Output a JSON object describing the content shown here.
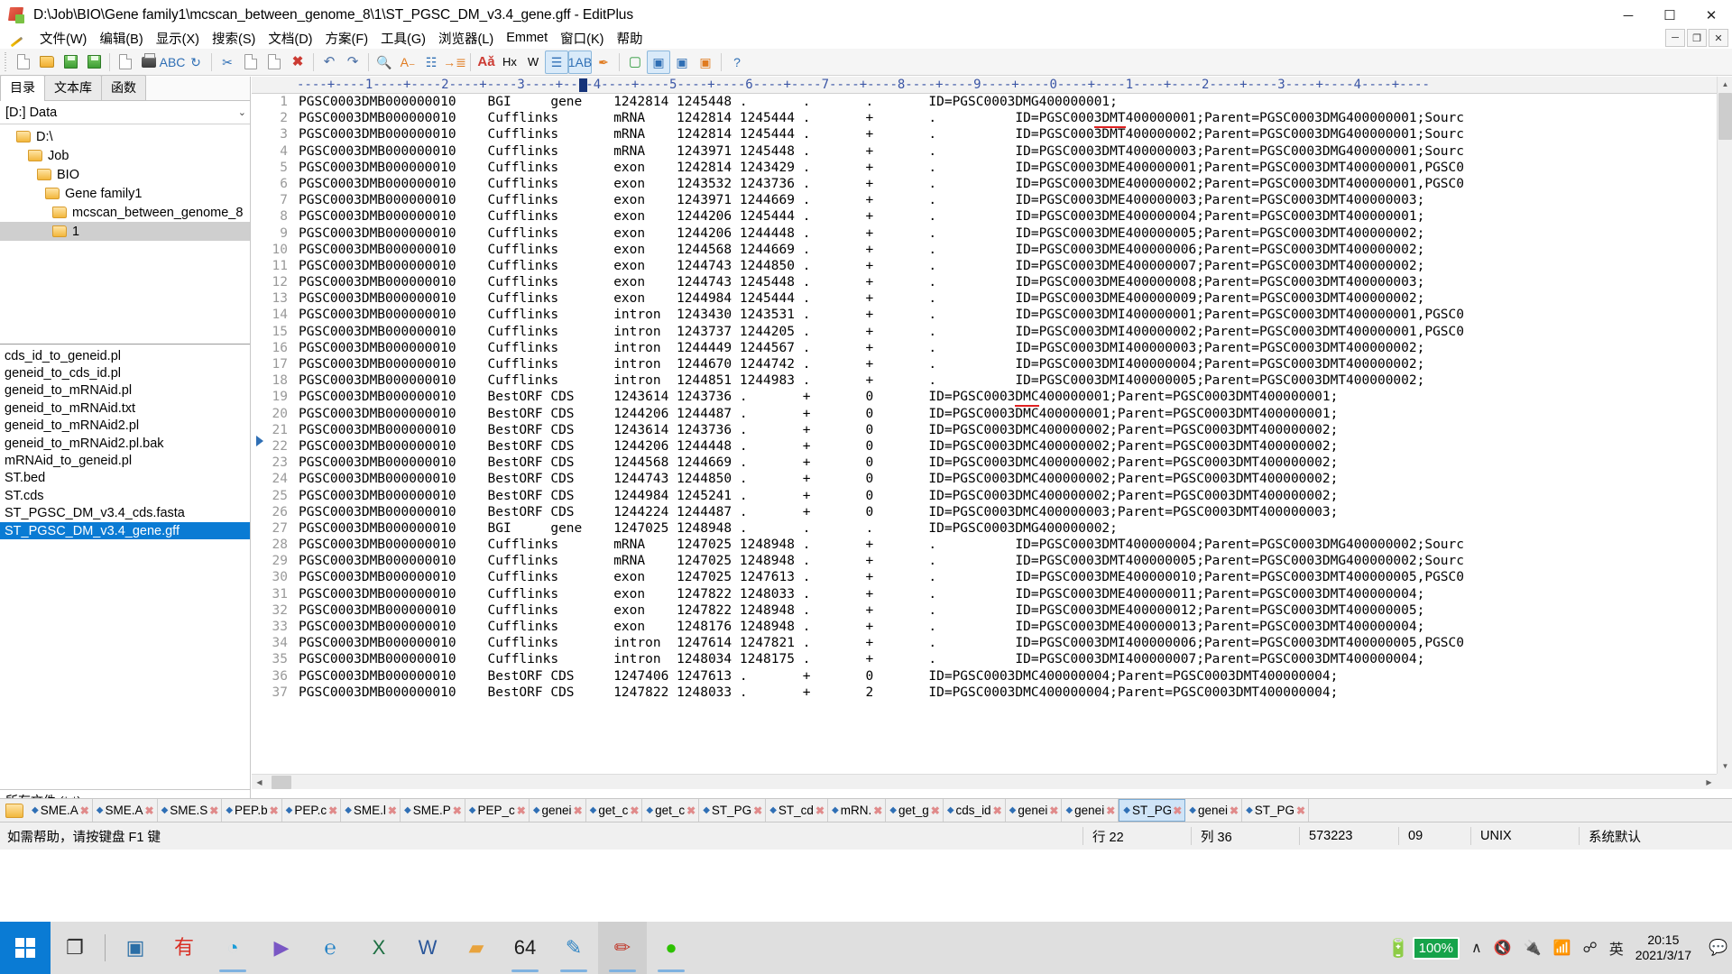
{
  "window": {
    "title": "D:\\Job\\BIO\\Gene family1\\mcscan_between_genome_8\\1\\ST_PGSC_DM_v3.4_gene.gff - EditPlus",
    "minimize": "─",
    "maximize": "☐",
    "close": "✕",
    "app_icon": "editplus-icon"
  },
  "menu": {
    "items": [
      {
        "label": "文件(W)"
      },
      {
        "label": "编辑(B)"
      },
      {
        "label": "显示(X)"
      },
      {
        "label": "搜索(S)"
      },
      {
        "label": "文档(D)"
      },
      {
        "label": "方案(F)"
      },
      {
        "label": "工具(G)"
      },
      {
        "label": "浏览器(L)"
      },
      {
        "label": "Emmet"
      },
      {
        "label": "窗口(K)"
      },
      {
        "label": "帮助"
      }
    ],
    "doc_buttons": [
      "─",
      "❐",
      "✕"
    ]
  },
  "toolbar": {
    "groups": [
      [
        "new-file-icon",
        "open-file-icon",
        "save-file-icon",
        "save-all-icon"
      ],
      [
        "print-preview-icon",
        "print-icon",
        "spell-check-icon",
        "reload-icon"
      ],
      [
        "cut-icon",
        "copy-icon",
        "paste-icon",
        "delete-icon"
      ],
      [
        "undo-icon",
        "redo-icon"
      ],
      [
        "find-icon",
        "replace-icon",
        "find-in-files-icon",
        "goto-line-icon"
      ],
      [
        "font-icon",
        "hex-viewer-icon",
        "word-wrap-icon"
      ],
      [
        "line-numbers-icon",
        "show-spaces-icon",
        "highlight-icon"
      ],
      [
        "preview-browser-icon",
        "browser-ie-icon",
        "browser-chrome-icon",
        "browser-firefox-icon"
      ],
      [
        "help-icon"
      ]
    ]
  },
  "sidebar": {
    "tabs": [
      {
        "label": "目录",
        "selected": true
      },
      {
        "label": "文本库",
        "selected": false
      },
      {
        "label": "函数",
        "selected": false
      }
    ],
    "drive": "[D:] Data",
    "drive_chevron": "⌄",
    "tree": [
      {
        "label": "D:\\",
        "depth": 0,
        "selected": false
      },
      {
        "label": "Job",
        "depth": 1,
        "selected": false
      },
      {
        "label": "BIO",
        "depth": 2,
        "selected": false
      },
      {
        "label": "Gene family1",
        "depth": 3,
        "selected": false
      },
      {
        "label": "mcscan_between_genome_8",
        "depth": 4,
        "selected": false
      },
      {
        "label": "1",
        "depth": 5,
        "selected": true
      }
    ],
    "files": [
      {
        "name": "cds_id_to_geneid.pl",
        "selected": false
      },
      {
        "name": "geneid_to_cds_id.pl",
        "selected": false
      },
      {
        "name": "geneid_to_mRNAid.pl",
        "selected": false
      },
      {
        "name": "geneid_to_mRNAid.txt",
        "selected": false
      },
      {
        "name": "geneid_to_mRNAid2.pl",
        "selected": false
      },
      {
        "name": "geneid_to_mRNAid2.pl.bak",
        "selected": false
      },
      {
        "name": "mRNAid_to_geneid.pl",
        "selected": false
      },
      {
        "name": "ST.bed",
        "selected": false
      },
      {
        "name": "ST.cds",
        "selected": false
      },
      {
        "name": "ST_PGSC_DM_v3.4_cds.fasta",
        "selected": false
      },
      {
        "name": "ST_PGSC_DM_v3.4_gene.gff",
        "selected": true
      }
    ],
    "filter": "所有文件 (*.*)",
    "filter_chevron": "⌄"
  },
  "editor": {
    "ruler": "----+----1----+----2----+----3----+----4----+----5----+----6----+----7----+----8----+----9----+----0----+----1----+----2----+----3----+----4----+----",
    "lines": [
      {
        "n": "1",
        "pre": "PGSC0003DMB000000010    BGI     gene    1242814 1245448 .       .       .       ID=PGSC0003DMG400000001;",
        "ul": "",
        "post": ""
      },
      {
        "n": "2",
        "pre": "PGSC0003DMB000000010    Cufflinks       mRNA    1242814 1245444 .       +       .          ID=PGSC000",
        "ul": "3DMT",
        "post": "400000001;Parent=PGSC0003DMG400000001;Sourc"
      },
      {
        "n": "3",
        "pre": "PGSC0003DMB000000010    Cufflinks       mRNA    1242814 1245444 .       +       .          ID=PGSC0003DMT400000002;Parent=PGSC0003DMG400000001;Sourc",
        "ul": "",
        "post": ""
      },
      {
        "n": "4",
        "pre": "PGSC0003DMB000000010    Cufflinks       mRNA    1243971 1245448 .       +       .          ID=PGSC0003DMT400000003;Parent=PGSC0003DMG400000001;Sourc",
        "ul": "",
        "post": ""
      },
      {
        "n": "5",
        "pre": "PGSC0003DMB000000010    Cufflinks       exon    1242814 1243429 .       +       .          ID=PGSC0003DME400000001;Parent=PGSC0003DMT400000001,PGSC0",
        "ul": "",
        "post": ""
      },
      {
        "n": "6",
        "pre": "PGSC0003DMB000000010    Cufflinks       exon    1243532 1243736 .       +       .          ID=PGSC0003DME400000002;Parent=PGSC0003DMT400000001,PGSC0",
        "ul": "",
        "post": ""
      },
      {
        "n": "7",
        "pre": "PGSC0003DMB000000010    Cufflinks       exon    1243971 1244669 .       +       .          ID=PGSC0003DME400000003;Parent=PGSC0003DMT400000003;",
        "ul": "",
        "post": ""
      },
      {
        "n": "8",
        "pre": "PGSC0003DMB000000010    Cufflinks       exon    1244206 1245444 .       +       .          ID=PGSC0003DME400000004;Parent=PGSC0003DMT400000001;",
        "ul": "",
        "post": ""
      },
      {
        "n": "9",
        "pre": "PGSC0003DMB000000010    Cufflinks       exon    1244206 1244448 .       +       .          ID=PGSC0003DME400000005;Parent=PGSC0003DMT400000002;",
        "ul": "",
        "post": ""
      },
      {
        "n": "10",
        "pre": "PGSC0003DMB000000010    Cufflinks       exon    1244568 1244669 .       +       .          ID=PGSC0003DME400000006;Parent=PGSC0003DMT400000002;",
        "ul": "",
        "post": ""
      },
      {
        "n": "11",
        "pre": "PGSC0003DMB000000010    Cufflinks       exon    1244743 1244850 .       +       .          ID=PGSC0003DME400000007;Parent=PGSC0003DMT400000002;",
        "ul": "",
        "post": ""
      },
      {
        "n": "12",
        "pre": "PGSC0003DMB000000010    Cufflinks       exon    1244743 1245448 .       +       .          ID=PGSC0003DME400000008;Parent=PGSC0003DMT400000003;",
        "ul": "",
        "post": ""
      },
      {
        "n": "13",
        "pre": "PGSC0003DMB000000010    Cufflinks       exon    1244984 1245444 .       +       .          ID=PGSC0003DME400000009;Parent=PGSC0003DMT400000002;",
        "ul": "",
        "post": ""
      },
      {
        "n": "14",
        "pre": "PGSC0003DMB000000010    Cufflinks       intron  1243430 1243531 .       +       .          ID=PGSC0003DMI400000001;Parent=PGSC0003DMT400000001,PGSC0",
        "ul": "",
        "post": ""
      },
      {
        "n": "15",
        "pre": "PGSC0003DMB000000010    Cufflinks       intron  1243737 1244205 .       +       .          ID=PGSC0003DMI400000002;Parent=PGSC0003DMT400000001,PGSC0",
        "ul": "",
        "post": ""
      },
      {
        "n": "16",
        "pre": "PGSC0003DMB000000010    Cufflinks       intron  1244449 1244567 .       +       .          ID=PGSC0003DMI400000003;Parent=PGSC0003DMT400000002;",
        "ul": "",
        "post": ""
      },
      {
        "n": "17",
        "pre": "PGSC0003DMB000000010    Cufflinks       intron  1244670 1244742 .       +       .          ID=PGSC0003DMI400000004;Parent=PGSC0003DMT400000002;",
        "ul": "",
        "post": ""
      },
      {
        "n": "18",
        "pre": "PGSC0003DMB000000010    Cufflinks       intron  1244851 1244983 .       +       .          ID=PGSC0003DMI400000005;Parent=PGSC0003DMT400000002;",
        "ul": "",
        "post": ""
      },
      {
        "n": "19",
        "pre": "PGSC0003DMB000000010    BestORF CDS     1243614 1243736 .       +       0       ID=PGSC0003",
        "ul": "DMC",
        "post": "400000001;Parent=PGSC0003DMT400000001;"
      },
      {
        "n": "20",
        "pre": "PGSC0003DMB000000010    BestORF CDS     1244206 1244487 .       +       0       ID=PGSC0003DMC400000001;Parent=PGSC0003DMT400000001;",
        "ul": "",
        "post": ""
      },
      {
        "n": "21",
        "pre": "PGSC0003DMB000000010    BestORF CDS     1243614 1243736 .       +       0       ID=PGSC0003DMC400000002;Parent=PGSC0003DMT400000002;",
        "ul": "",
        "post": ""
      },
      {
        "n": "22",
        "pre": "PGSC0003DMB000000010    BestORF CDS     1244206 1244448 .       +       0       ID=PGSC0003DMC400000002;Parent=PGSC0003DMT400000002;",
        "ul": "",
        "post": ""
      },
      {
        "n": "23",
        "pre": "PGSC0003DMB000000010    BestORF CDS     1244568 1244669 .       +       0       ID=PGSC0003DMC400000002;Parent=PGSC0003DMT400000002;",
        "ul": "",
        "post": ""
      },
      {
        "n": "24",
        "pre": "PGSC0003DMB000000010    BestORF CDS     1244743 1244850 .       +       0       ID=PGSC0003DMC400000002;Parent=PGSC0003DMT400000002;",
        "ul": "",
        "post": ""
      },
      {
        "n": "25",
        "pre": "PGSC0003DMB000000010    BestORF CDS     1244984 1245241 .       +       0       ID=PGSC0003DMC400000002;Parent=PGSC0003DMT400000002;",
        "ul": "",
        "post": ""
      },
      {
        "n": "26",
        "pre": "PGSC0003DMB000000010    BestORF CDS     1244224 1244487 .       +       0       ID=PGSC0003DMC400000003;Parent=PGSC0003DMT400000003;",
        "ul": "",
        "post": ""
      },
      {
        "n": "27",
        "pre": "PGSC0003DMB000000010    BGI     gene    1247025 1248948 .       .       .       ID=PGSC0003DMG400000002;",
        "ul": "",
        "post": ""
      },
      {
        "n": "28",
        "pre": "PGSC0003DMB000000010    Cufflinks       mRNA    1247025 1248948 .       +       .          ID=PGSC0003DMT400000004;Parent=PGSC0003DMG400000002;Sourc",
        "ul": "",
        "post": ""
      },
      {
        "n": "29",
        "pre": "PGSC0003DMB000000010    Cufflinks       mRNA    1247025 1248948 .       +       .          ID=PGSC0003DMT400000005;Parent=PGSC0003DMG400000002;Sourc",
        "ul": "",
        "post": ""
      },
      {
        "n": "30",
        "pre": "PGSC0003DMB000000010    Cufflinks       exon    1247025 1247613 .       +       .          ID=PGSC0003DME400000010;Parent=PGSC0003DMT400000005,PGSC0",
        "ul": "",
        "post": ""
      },
      {
        "n": "31",
        "pre": "PGSC0003DMB000000010    Cufflinks       exon    1247822 1248033 .       +       .          ID=PGSC0003DME400000011;Parent=PGSC0003DMT400000004;",
        "ul": "",
        "post": ""
      },
      {
        "n": "32",
        "pre": "PGSC0003DMB000000010    Cufflinks       exon    1247822 1248948 .       +       .          ID=PGSC0003DME400000012;Parent=PGSC0003DMT400000005;",
        "ul": "",
        "post": ""
      },
      {
        "n": "33",
        "pre": "PGSC0003DMB000000010    Cufflinks       exon    1248176 1248948 .       +       .          ID=PGSC0003DME400000013;Parent=PGSC0003DMT400000004;",
        "ul": "",
        "post": ""
      },
      {
        "n": "34",
        "pre": "PGSC0003DMB000000010    Cufflinks       intron  1247614 1247821 .       +       .          ID=PGSC0003DMI400000006;Parent=PGSC0003DMT400000005,PGSC0",
        "ul": "",
        "post": ""
      },
      {
        "n": "35",
        "pre": "PGSC0003DMB000000010    Cufflinks       intron  1248034 1248175 .       +       .          ID=PGSC0003DMI400000007;Parent=PGSC0003DMT400000004;",
        "ul": "",
        "post": ""
      },
      {
        "n": "36",
        "pre": "PGSC0003DMB000000010    BestORF CDS     1247406 1247613 .       +       0       ID=PGSC0003DMC400000004;Parent=PGSC0003DMT400000004;",
        "ul": "",
        "post": ""
      },
      {
        "n": "37",
        "pre": "PGSC0003DMB000000010    BestORF CDS     1247822 1248033 .       +       2       ID=PGSC0003DMC400000004;Parent=PGSC0003DMT400000004;",
        "ul": "",
        "post": ""
      }
    ]
  },
  "doctabs": [
    {
      "label": "SME.A",
      "selected": false
    },
    {
      "label": "SME.A",
      "selected": false
    },
    {
      "label": "SME.S",
      "selected": false
    },
    {
      "label": "PEP.b",
      "selected": false
    },
    {
      "label": "PEP.c",
      "selected": false
    },
    {
      "label": "SME.l",
      "selected": false
    },
    {
      "label": "SME.P",
      "selected": false
    },
    {
      "label": "PEP_c",
      "selected": false
    },
    {
      "label": "genei",
      "selected": false
    },
    {
      "label": "get_c",
      "selected": false
    },
    {
      "label": "get_c",
      "selected": false
    },
    {
      "label": "ST_PG",
      "selected": false
    },
    {
      "label": "ST_cd",
      "selected": false
    },
    {
      "label": "mRN.",
      "selected": false
    },
    {
      "label": "get_g",
      "selected": false
    },
    {
      "label": "cds_id",
      "selected": false
    },
    {
      "label": "genei",
      "selected": false
    },
    {
      "label": "genei",
      "selected": false
    },
    {
      "label": "ST_PG",
      "selected": true
    },
    {
      "label": "genei",
      "selected": false
    },
    {
      "label": "ST_PG",
      "selected": false
    }
  ],
  "statusbar": {
    "hint": "如需帮助，请按键盘 F1 键",
    "row": "行 22",
    "col": "列 36",
    "offset": "573223",
    "sel": "09",
    "encoding": "UNIX",
    "charset": "系统默认"
  },
  "taskbar": {
    "start": "windows-start-icon",
    "items": [
      {
        "name": "task-view-icon",
        "glyph": "❐",
        "color": "#2b2b2b",
        "running": false
      },
      {
        "name": "virtualbox-icon",
        "glyph": "▣",
        "color": "#2a6ea6",
        "running": false
      },
      {
        "name": "youdao-dict-icon",
        "glyph": "有",
        "color": "#d93025",
        "running": false
      },
      {
        "name": "edge-browser-icon",
        "glyph": "◔",
        "color": "#1a9cd7",
        "running": true
      },
      {
        "name": "media-player-icon",
        "glyph": "▶",
        "color": "#7a57c4",
        "running": false
      },
      {
        "name": "internet-explorer-icon",
        "glyph": "℮",
        "color": "#1f7fc4",
        "running": false
      },
      {
        "name": "excel-icon",
        "glyph": "X",
        "color": "#1d6f42",
        "running": false
      },
      {
        "name": "word-icon",
        "glyph": "W",
        "color": "#2b579a",
        "running": false
      },
      {
        "name": "file-explorer-icon",
        "glyph": "▰",
        "color": "#e8a33d",
        "running": false
      },
      {
        "name": "terminal-icon",
        "glyph": "64",
        "color": "#1b1b1b",
        "running": true
      },
      {
        "name": "notepad-icon",
        "glyph": "✎",
        "color": "#2e84c4",
        "running": true
      },
      {
        "name": "editplus-icon",
        "glyph": "✏",
        "color": "#c0392b",
        "running": true,
        "active": true
      },
      {
        "name": "wechat-icon",
        "glyph": "●",
        "color": "#2dc100",
        "running": true
      }
    ],
    "tray": {
      "battery_percent": "100%",
      "chevron": "∧",
      "volume": "volume-muted-icon",
      "power": "power-plug-icon",
      "network": "wifi-icon",
      "bluetooth": "bluetooth-icon",
      "ime": "英",
      "time": "20:15",
      "date": "2021/3/17"
    }
  }
}
